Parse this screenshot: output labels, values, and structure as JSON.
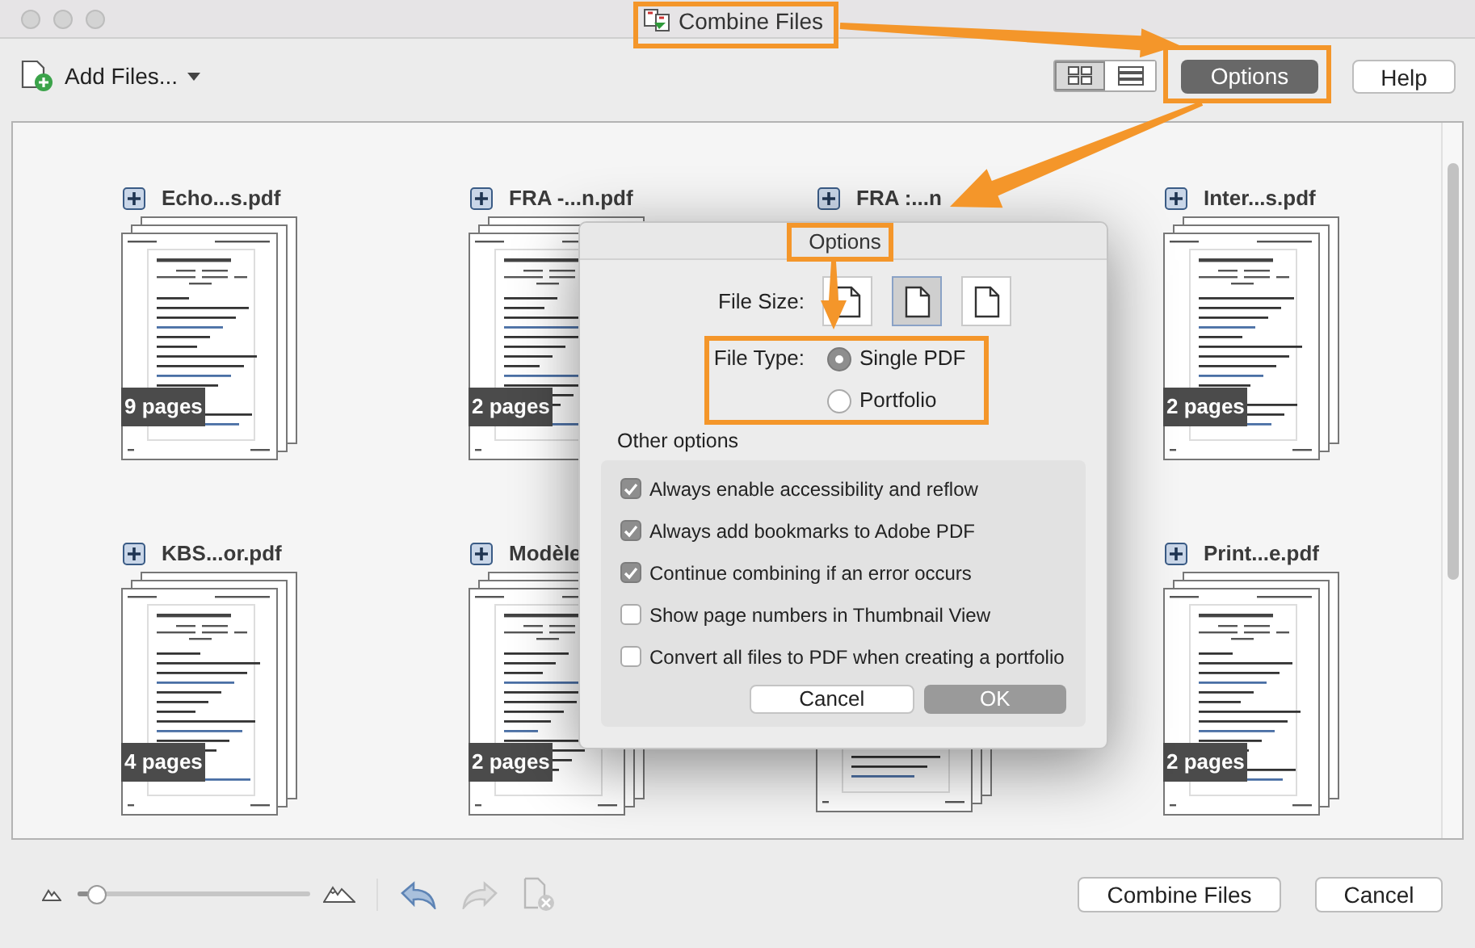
{
  "window": {
    "title": "Combine Files"
  },
  "toolbar": {
    "add_files": "Add Files...",
    "view_modes": [
      {
        "kind": "grid",
        "selected": true
      },
      {
        "kind": "list",
        "selected": false
      }
    ],
    "options_button": "Options",
    "help_button": "Help"
  },
  "files": [
    {
      "kind": "pdf",
      "name": "Echo...s.pdf",
      "pages": "9 pages"
    },
    {
      "kind": "pdf",
      "name": "FRA -...n.pdf",
      "pages": "2 pages"
    },
    {
      "kind": "label",
      "name": "FRA :...n"
    },
    {
      "kind": "pdf",
      "name": "Inter...s.pdf",
      "pages": "2 pages"
    },
    {
      "kind": "pdf",
      "name": "KBS...or.pdf",
      "pages": "4 pages"
    },
    {
      "kind": "pdf",
      "name": "Modèle",
      "pages": "2 pages"
    },
    {
      "kind": "stack"
    },
    {
      "kind": "pdf",
      "name": "Print...e.pdf",
      "pages": "2 pages"
    }
  ],
  "options_dialog": {
    "title": "Options",
    "file_size_label": "File Size:",
    "file_sizes": [
      {
        "selected": false
      },
      {
        "selected": true
      },
      {
        "selected": false
      }
    ],
    "file_type_label": "File Type:",
    "file_types": [
      {
        "label": "Single PDF",
        "selected": true
      },
      {
        "label": "Portfolio",
        "selected": false
      }
    ],
    "other_options_label": "Other options",
    "options": [
      {
        "label": "Always enable accessibility and reflow",
        "checked": true
      },
      {
        "label": "Always add bookmarks to Adobe PDF",
        "checked": true
      },
      {
        "label": "Continue combining if an error occurs",
        "checked": true
      },
      {
        "label": "Show page numbers in Thumbnail View",
        "checked": false
      },
      {
        "label": "Convert all files to PDF when creating a portfolio",
        "checked": false
      }
    ],
    "cancel_button": "Cancel",
    "ok_button": "OK"
  },
  "footer": {
    "zoom": {
      "level": 0.08
    },
    "tools": [
      {
        "kind": "undo",
        "disabled": false
      },
      {
        "kind": "redo",
        "disabled": true
      },
      {
        "kind": "remove",
        "disabled": true
      }
    ],
    "combine_button": "Combine Files",
    "cancel_button": "Cancel"
  }
}
